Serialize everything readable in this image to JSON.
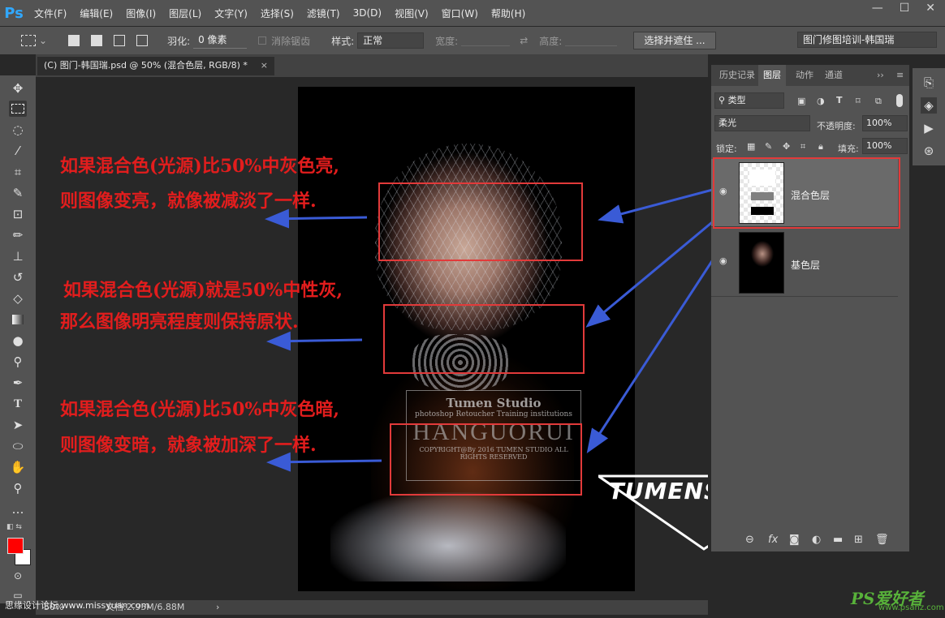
{
  "app": {
    "logo": "Ps"
  },
  "menu": [
    "文件(F)",
    "编辑(E)",
    "图像(I)",
    "图层(L)",
    "文字(Y)",
    "选择(S)",
    "滤镜(T)",
    "3D(D)",
    "视图(V)",
    "窗口(W)",
    "帮助(H)"
  ],
  "window_controls": {
    "minimize": "—",
    "restore": "☐",
    "close": "✕"
  },
  "options": {
    "feather_label": "羽化:",
    "feather_value": "0 像素",
    "antialias_label": "消除锯齿",
    "style_label": "样式:",
    "style_value": "正常",
    "width_label": "宽度:",
    "height_label": "高度:",
    "select_mask_button": "选择并遮住 ...",
    "workspace": "图门修图培训-韩国瑞"
  },
  "document": {
    "tab_title": "(C) 图门-韩国瑞.psd @ 50% (混合色层, RGB/8) *",
    "tab_close": "×"
  },
  "annotations": [
    {
      "line1": "如果混合色(光源)比50%中灰色亮,",
      "line2": "则图像变亮，就像被减淡了一样."
    },
    {
      "line1": "如果混合色(光源)就是50%中性灰,",
      "line2": "那么图像明亮程度则保持原状."
    },
    {
      "line1": "如果混合色(光源)比50%中灰色暗,",
      "line2": "则图像变暗，就象被加深了一样."
    }
  ],
  "watermark": {
    "line1": "Tumen Studio",
    "line2": "photoshop Retoucher Training institutions",
    "line3": "HANGUORUI",
    "line4": "COPYRIGHT@By 2016 TUMEN STUDIO ALL RIGHTS RESERVED"
  },
  "logo_badge": "TUMENSTUDIO",
  "status": {
    "zoom": "50%",
    "doc_size": "文档:2.95M/6.88M",
    "overlay_text": "思缘设计论坛 www.missyuan.com"
  },
  "panel": {
    "tabs": [
      "历史记录",
      "图层",
      "动作",
      "通道"
    ],
    "active_tab": "图层",
    "filter_label": "类型",
    "blend_mode": "柔光",
    "opacity_label": "不透明度:",
    "opacity_value": "100%",
    "lock_label": "锁定:",
    "fill_label": "填充:",
    "fill_value": "100%",
    "layers": [
      {
        "name": "混合色层",
        "selected": true,
        "visible": true
      },
      {
        "name": "基色层",
        "selected": false,
        "visible": true
      }
    ]
  },
  "site_watermark": {
    "main": "PS爱好者",
    "sub": "www.psahz.com"
  },
  "colors": {
    "foreground": "#ff0000",
    "background": "#ffffff",
    "accent": "#e23a3a",
    "arrow": "#3a5bd6"
  }
}
